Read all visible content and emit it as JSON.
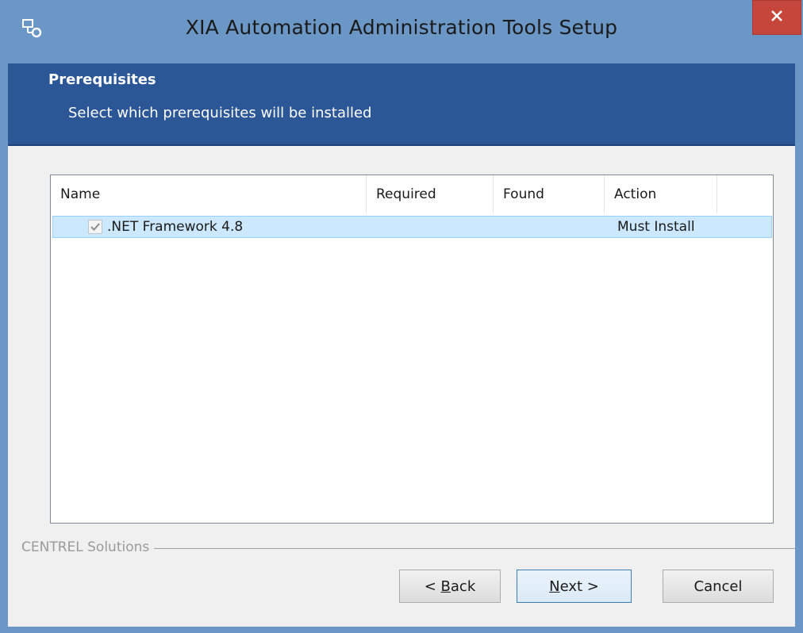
{
  "window": {
    "title": "XIA Automation Administration Tools Setup"
  },
  "header": {
    "title": "Prerequisites",
    "subtitle": "Select which prerequisites will be installed"
  },
  "table": {
    "columns": [
      "Name",
      "Required",
      "Found",
      "Action"
    ],
    "rows": [
      {
        "checked": true,
        "name": ".NET Framework 4.8",
        "required": "",
        "found": "",
        "action": "Must Install"
      }
    ]
  },
  "footer": {
    "brand": "CENTREL Solutions",
    "back_label_pre": "< ",
    "back_label_u": "B",
    "back_label_post": "ack",
    "next_label_u": "N",
    "next_label_post": "ext >",
    "cancel_label": "Cancel"
  },
  "colors": {
    "titlebar": "#6b97c6",
    "header_band": "#2b5797",
    "close_button": "#c7463c",
    "selection": "#cce8ff"
  },
  "icons": {
    "app": "installer-icon",
    "close": "close-icon",
    "check": "checkmark-icon"
  }
}
